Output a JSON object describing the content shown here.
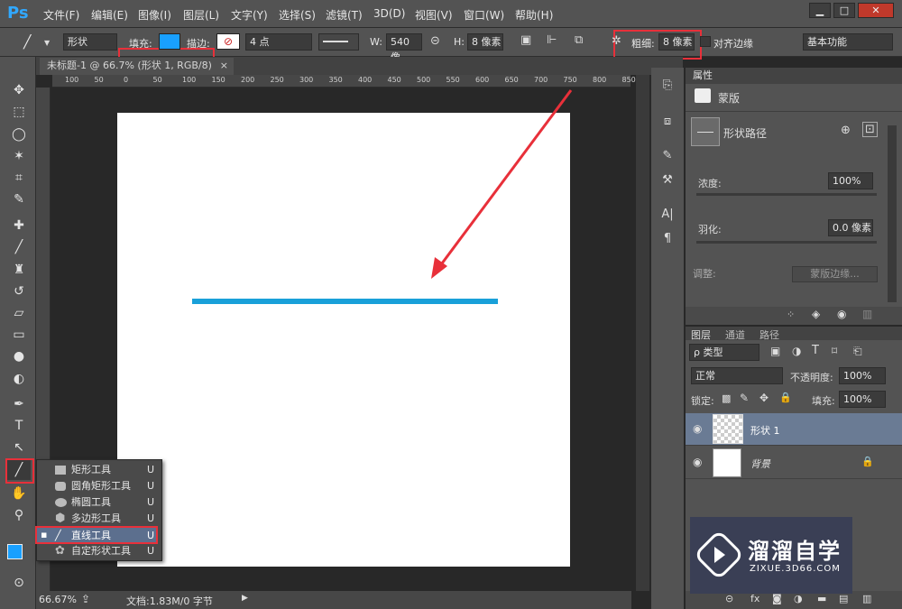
{
  "menubar": {
    "logo": "Ps",
    "items": [
      "文件(F)",
      "编辑(E)",
      "图像(I)",
      "图层(L)",
      "文字(Y)",
      "选择(S)",
      "滤镜(T)",
      "3D(D)",
      "视图(V)",
      "窗口(W)",
      "帮助(H)"
    ]
  },
  "options": {
    "mode": "形状",
    "fill_label": "填充:",
    "stroke_label": "描边:",
    "stroke_size": "4 点",
    "w_label": "W:",
    "w_value": "540 像",
    "h_label": "H:",
    "h_value": "8 像素",
    "weight_label": "粗细:",
    "weight_value": "8 像素",
    "align_label": "对齐边缘",
    "workspace": "基本功能",
    "fill_color": "#19a0ff"
  },
  "document": {
    "tab_title": "未标题-1 @ 66.7% (形状 1, RGB/8)",
    "close": "×",
    "zoom": "66.67%",
    "status": "文档:1.83M/0 字节",
    "ruler_ticks": [
      "100",
      "50",
      "0",
      "50",
      "100",
      "150",
      "200",
      "250",
      "300",
      "350",
      "400",
      "450",
      "500",
      "550",
      "600",
      "650",
      "700",
      "750",
      "800",
      "850"
    ],
    "line_color": "#19a0d9"
  },
  "flyout": {
    "items": [
      {
        "label": "矩形工具",
        "key": "U"
      },
      {
        "label": "圆角矩形工具",
        "key": "U"
      },
      {
        "label": "椭圆工具",
        "key": "U"
      },
      {
        "label": "多边形工具",
        "key": "U"
      },
      {
        "label": "直线工具",
        "key": "U"
      },
      {
        "label": "自定形状工具",
        "key": "U"
      }
    ]
  },
  "properties": {
    "tab": "属性",
    "mask_label": "蒙版",
    "shape_path": "形状路径",
    "density_label": "浓度:",
    "density_value": "100%",
    "feather_label": "羽化:",
    "feather_value": "0.0 像素",
    "adjust_label": "调整:",
    "mask_edge_btn": "蒙版边缘..."
  },
  "layers": {
    "tabs": [
      "图层",
      "通道",
      "路径"
    ],
    "filter_label": "ρ 类型",
    "blend_mode": "正常",
    "opacity_label": "不透明度:",
    "opacity_value": "100%",
    "lock_label": "锁定:",
    "fill_label": "填充:",
    "fill_value": "100%",
    "items": [
      {
        "name": "形状 1"
      },
      {
        "name": "背景"
      }
    ]
  },
  "watermark": {
    "title": "溜溜自学",
    "url": "ZIXUE.3D66.COM"
  }
}
